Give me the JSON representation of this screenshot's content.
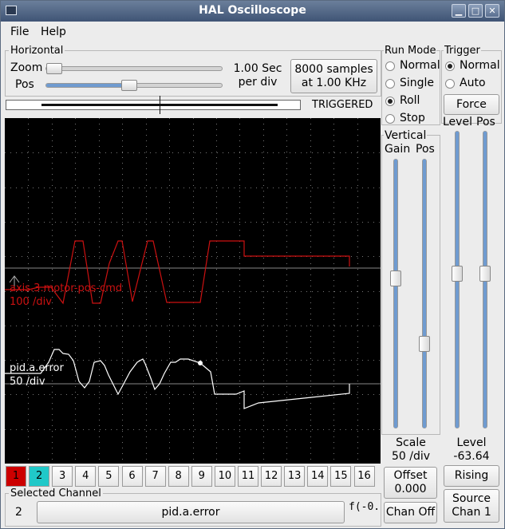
{
  "window": {
    "title": "HAL Oscilloscope"
  },
  "menu": {
    "file": "File",
    "help": "Help"
  },
  "horizontal": {
    "group_label": "Horizontal",
    "zoom_label": "Zoom",
    "pos_label": "Pos",
    "zoom_level": 0.0,
    "pos_level": 0.47,
    "rate_line1": "1.00 Sec",
    "rate_line2": "per div",
    "samples_line1": "8000 samples",
    "samples_line2": "at 1.00 KHz",
    "trigger_status": "TRIGGERED"
  },
  "run_mode": {
    "label": "Run Mode",
    "options": [
      "Normal",
      "Single",
      "Roll",
      "Stop"
    ],
    "selected": "Roll"
  },
  "trigger": {
    "label": "Trigger",
    "options": [
      "Normal",
      "Auto"
    ],
    "selected": "Normal",
    "force_label": "Force",
    "level_label": "Level",
    "pos_label": "Pos",
    "level_slider": 0.52,
    "pos_slider": 0.52,
    "level_value_label": "Level",
    "level_value": "-63.64",
    "edge_button": "Rising",
    "source_line1": "Source",
    "source_line2": "Chan  1"
  },
  "vertical": {
    "label": "Vertical",
    "gain_label": "Gain",
    "pos_label": "Pos",
    "gain_slider": 0.56,
    "pos_slider": 0.3,
    "scale_label": "Scale",
    "scale_value": "50 /div",
    "offset_label": "Offset",
    "offset_value": "0.000",
    "chan_off_label": "Chan Off"
  },
  "traces": [
    {
      "name": "axis.3.motor-pos-cmd",
      "scale": "100 /div",
      "color": "#cc1111"
    },
    {
      "name": "pid.a.error",
      "scale": "50 /div",
      "color": "#ffffff"
    }
  ],
  "channels": {
    "buttons": [
      "1",
      "2",
      "3",
      "4",
      "5",
      "6",
      "7",
      "8",
      "9",
      "10",
      "11",
      "12",
      "13",
      "14",
      "15",
      "16"
    ],
    "colors": {
      "1": "#cc0000",
      "2": "#20c8c8"
    },
    "selected_label": "Selected Channel",
    "selected_number": "2",
    "selected_name": "pid.a.error",
    "func_text": "f(-0."
  }
}
